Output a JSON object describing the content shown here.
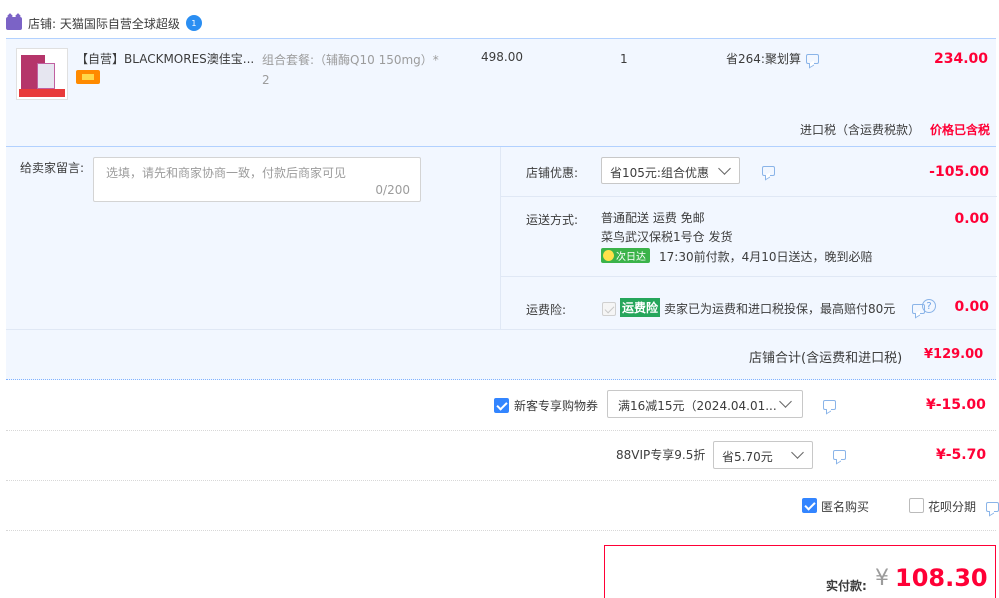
{
  "shop": {
    "label": "店铺: 天猫国际自营全球超级",
    "badge": "1"
  },
  "item": {
    "title": "【自营】BLACKMORES澳佳宝...",
    "sku": "组合套餐:（辅酶Q10 150mg）* 2",
    "price": "498.00",
    "quantity": "1",
    "saving": "省264:聚划算",
    "subtotal": "234.00"
  },
  "tax": {
    "label": "进口税（含运费税款）",
    "status": "价格已含税"
  },
  "memo": {
    "label": "给卖家留言:",
    "placeholder": "选填，请先和商家协商一致，付款后商家可见",
    "counter": "0/200"
  },
  "store_discount": {
    "label": "店铺优惠:",
    "selected": "省105元:组合优惠",
    "amount": "-105.00"
  },
  "shipping": {
    "label": "运送方式:",
    "method": "普通配送 运费 免邮",
    "warehouse": "菜鸟武汉保税1号仓   发货",
    "badge": "次日达",
    "promise": "17:30前付款，4月10日送达，晚到必赔",
    "amount": "0.00"
  },
  "insurance": {
    "label": "运费险:",
    "tag": "运费险",
    "description": "卖家已为运费和进口税投保，最高赔付80元",
    "help": "?",
    "amount": "0.00"
  },
  "store_total": {
    "label": "店铺合计(含运费和进口税)",
    "value": "¥129.00"
  },
  "coupon": {
    "label": "新客专享购物券",
    "selected": "满16减15元（2024.04.01...",
    "amount": "¥-15.00"
  },
  "vip": {
    "label": "88VIP专享9.5折",
    "selected": "省5.70元",
    "amount": "¥-5.70"
  },
  "options": {
    "anonymous": "匿名购买",
    "huabei": "花呗分期"
  },
  "payment": {
    "label": "实付款:",
    "currency": "¥",
    "amount": "108.30"
  }
}
